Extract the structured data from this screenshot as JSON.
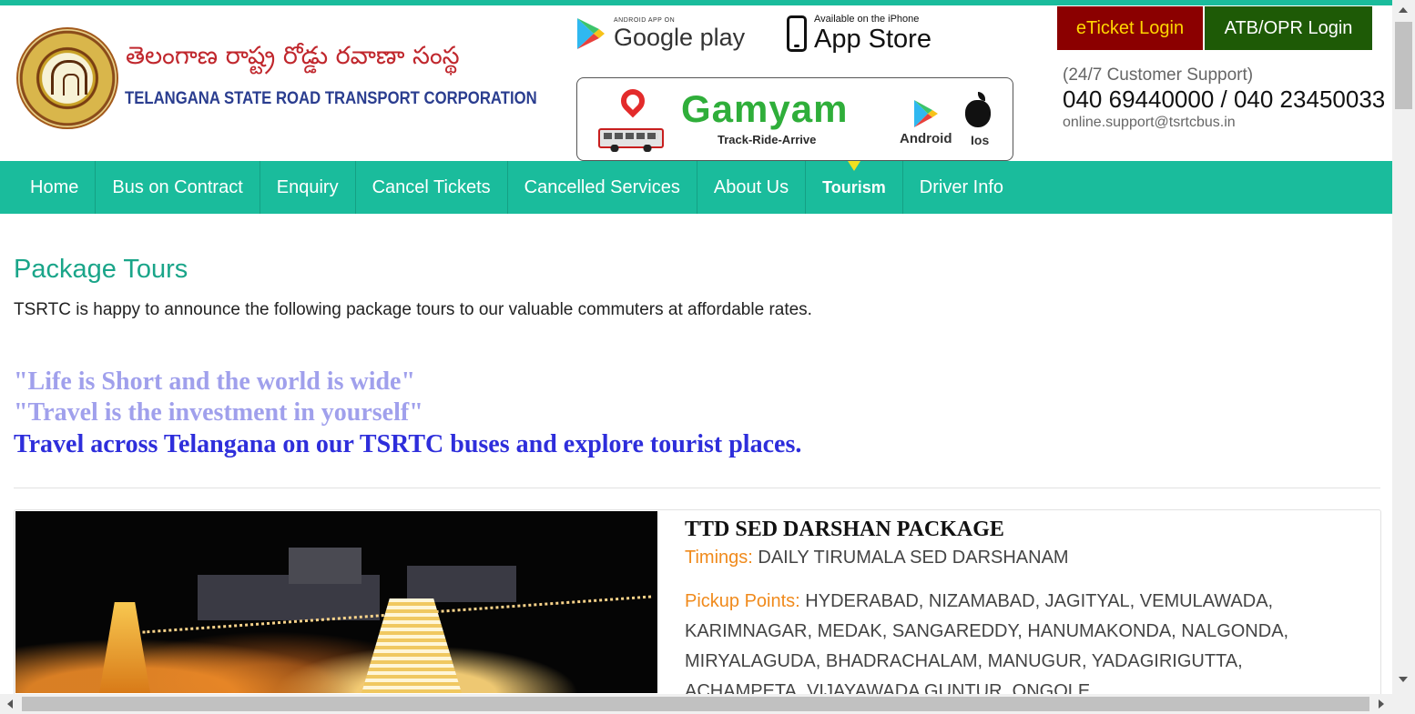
{
  "header": {
    "logo_telugu": "తెలంగాణ  రాష్ట్ర రోడ్డు రవాణా సంస్థ",
    "logo_english": "TELANGANA STATE ROAD TRANSPORT CORPORATION",
    "google_play": {
      "small": "ANDROID APP ON",
      "big": "Google play"
    },
    "app_store": {
      "small": "Available on the iPhone",
      "big": "App Store"
    },
    "gamyam": {
      "title": "Gamyam",
      "tagline": "Track-Ride-Arrive",
      "android": "Android",
      "ios": "Ios"
    },
    "eticket_login": "eTicket Login",
    "atb_login": "ATB/OPR Login",
    "support_label": "(24/7 Customer Support)",
    "support_phone": "040 69440000 / 040 23450033",
    "support_email": "online.support@tsrtcbus.in",
    "colors": {
      "accent": "#1abc9c",
      "eticket_bg": "#8b0000",
      "eticket_text": "#ffd700",
      "atb_bg": "#1e5a06"
    }
  },
  "nav": {
    "items": [
      {
        "label": "Home"
      },
      {
        "label": "Bus on Contract"
      },
      {
        "label": "Enquiry"
      },
      {
        "label": "Cancel Tickets"
      },
      {
        "label": "Cancelled Services"
      },
      {
        "label": "About Us"
      },
      {
        "label": "Tourism",
        "active": true
      },
      {
        "label": "Driver Info"
      }
    ]
  },
  "content": {
    "title": "Package Tours",
    "intro": "TSRTC is happy to announce the following package tours to our valuable commuters at affordable rates.",
    "quotes": [
      "\"Life is Short and the world is wide\"",
      "\"Travel is the investment in yourself\"",
      "Travel across Telangana on our TSRTC buses and explore tourist places."
    ]
  },
  "package": {
    "title": "TTD SED DARSHAN PACKAGE",
    "timings_label": "Timings:",
    "timings_value": "DAILY TIRUMALA SED DARSHANAM",
    "pickup_label": "Pickup Points:",
    "pickup_value": "HYDERABAD, NIZAMABAD, JAGITYAL, VEMULAWADA, KARIMNAGAR, MEDAK, SANGAREDDY, HANUMAKONDA, NALGONDA, MIRYALAGUDA, BHADRACHALAM, MANUGUR, YADAGIRIGUTTA, ACHAMPETA, VIJAYAWADA GUNTUR, ONGOLE"
  }
}
